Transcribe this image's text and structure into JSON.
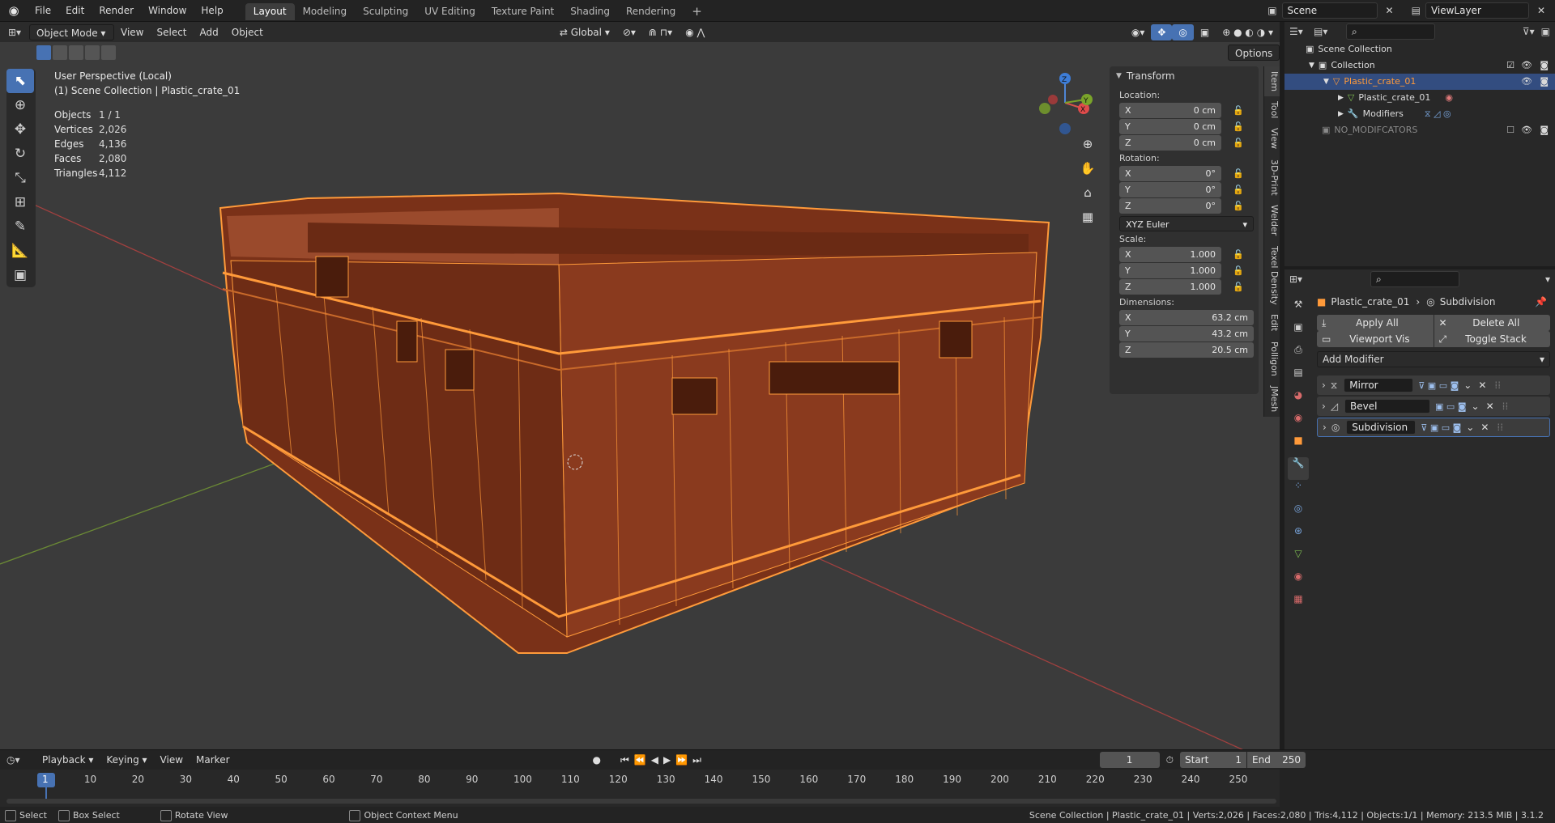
{
  "topbar": {
    "menus": [
      "File",
      "Edit",
      "Render",
      "Window",
      "Help"
    ],
    "workspaces": [
      "Layout",
      "Modeling",
      "Sculpting",
      "UV Editing",
      "Texture Paint",
      "Shading",
      "Rendering"
    ],
    "active_workspace": "Layout",
    "scene": "Scene",
    "view_layer": "ViewLayer"
  },
  "viewport": {
    "mode": "Object Mode",
    "menus": [
      "View",
      "Select",
      "Add",
      "Object"
    ],
    "orientation": "Global",
    "options_label": "Options",
    "overlay_title": "User Perspective (Local)",
    "overlay_sub": "(1) Scene Collection | Plastic_crate_01",
    "stats": [
      {
        "label": "Objects",
        "value": "1 / 1"
      },
      {
        "label": "Vertices",
        "value": "2,026"
      },
      {
        "label": "Edges",
        "value": "4,136"
      },
      {
        "label": "Faces",
        "value": "2,080"
      },
      {
        "label": "Triangles",
        "value": "4,112"
      }
    ],
    "gizmo": {
      "x": "X",
      "y": "Y",
      "z": "Z"
    }
  },
  "npanel": {
    "title": "Transform",
    "location_label": "Location:",
    "location": [
      {
        "axis": "X",
        "value": "0 cm"
      },
      {
        "axis": "Y",
        "value": "0 cm"
      },
      {
        "axis": "Z",
        "value": "0 cm"
      }
    ],
    "rotation_label": "Rotation:",
    "rotation": [
      {
        "axis": "X",
        "value": "0°"
      },
      {
        "axis": "Y",
        "value": "0°"
      },
      {
        "axis": "Z",
        "value": "0°"
      }
    ],
    "rotation_mode": "XYZ Euler",
    "scale_label": "Scale:",
    "scale": [
      {
        "axis": "X",
        "value": "1.000"
      },
      {
        "axis": "Y",
        "value": "1.000"
      },
      {
        "axis": "Z",
        "value": "1.000"
      }
    ],
    "dimensions_label": "Dimensions:",
    "dimensions": [
      {
        "axis": "X",
        "value": "63.2 cm"
      },
      {
        "axis": "Y",
        "value": "43.2 cm"
      },
      {
        "axis": "Z",
        "value": "20.5 cm"
      }
    ],
    "tabs": [
      "Item",
      "Tool",
      "View",
      "3D-Print",
      "Welder",
      "Texel Density",
      "Edit",
      "Polligon",
      "JMesh"
    ]
  },
  "outliner": {
    "items": [
      {
        "label": "Scene Collection"
      },
      {
        "label": "Collection"
      },
      {
        "label": "Plastic_crate_01"
      },
      {
        "label": "Plastic_crate_01"
      },
      {
        "label": "Modifiers"
      },
      {
        "label": "NO_MODIFCATORS"
      }
    ]
  },
  "properties": {
    "object_name": "Plastic_crate_01",
    "modifier_name": "Subdivision",
    "apply_all": "Apply All",
    "delete_all": "Delete All",
    "viewport_vis": "Viewport Vis",
    "toggle_stack": "Toggle Stack",
    "add_modifier": "Add Modifier",
    "modifiers": [
      {
        "name": "Mirror"
      },
      {
        "name": "Bevel"
      },
      {
        "name": "Subdivision"
      }
    ]
  },
  "timeline": {
    "menus": [
      "Playback",
      "Keying",
      "View",
      "Marker"
    ],
    "current_frame": "1",
    "start_label": "Start",
    "start": "1",
    "end_label": "End",
    "end": "250",
    "ticks": [
      "1",
      "10",
      "20",
      "30",
      "40",
      "50",
      "60",
      "70",
      "80",
      "90",
      "100",
      "110",
      "120",
      "130",
      "140",
      "150",
      "160",
      "170",
      "180",
      "190",
      "200",
      "210",
      "220",
      "230",
      "240",
      "250"
    ]
  },
  "status": {
    "select": "Select",
    "box_select": "Box Select",
    "rotate_view": "Rotate View",
    "context_menu": "Object Context Menu",
    "info": "Scene Collection | Plastic_crate_01 | Verts:2,026 | Faces:2,080 | Tris:4,112 | Objects:1/1 | Memory: 213.5 MiB | 3.1.2"
  },
  "colors": {
    "accent": "#4772b3",
    "selection": "#ff8a2b",
    "crate": "#8a3a1e"
  }
}
